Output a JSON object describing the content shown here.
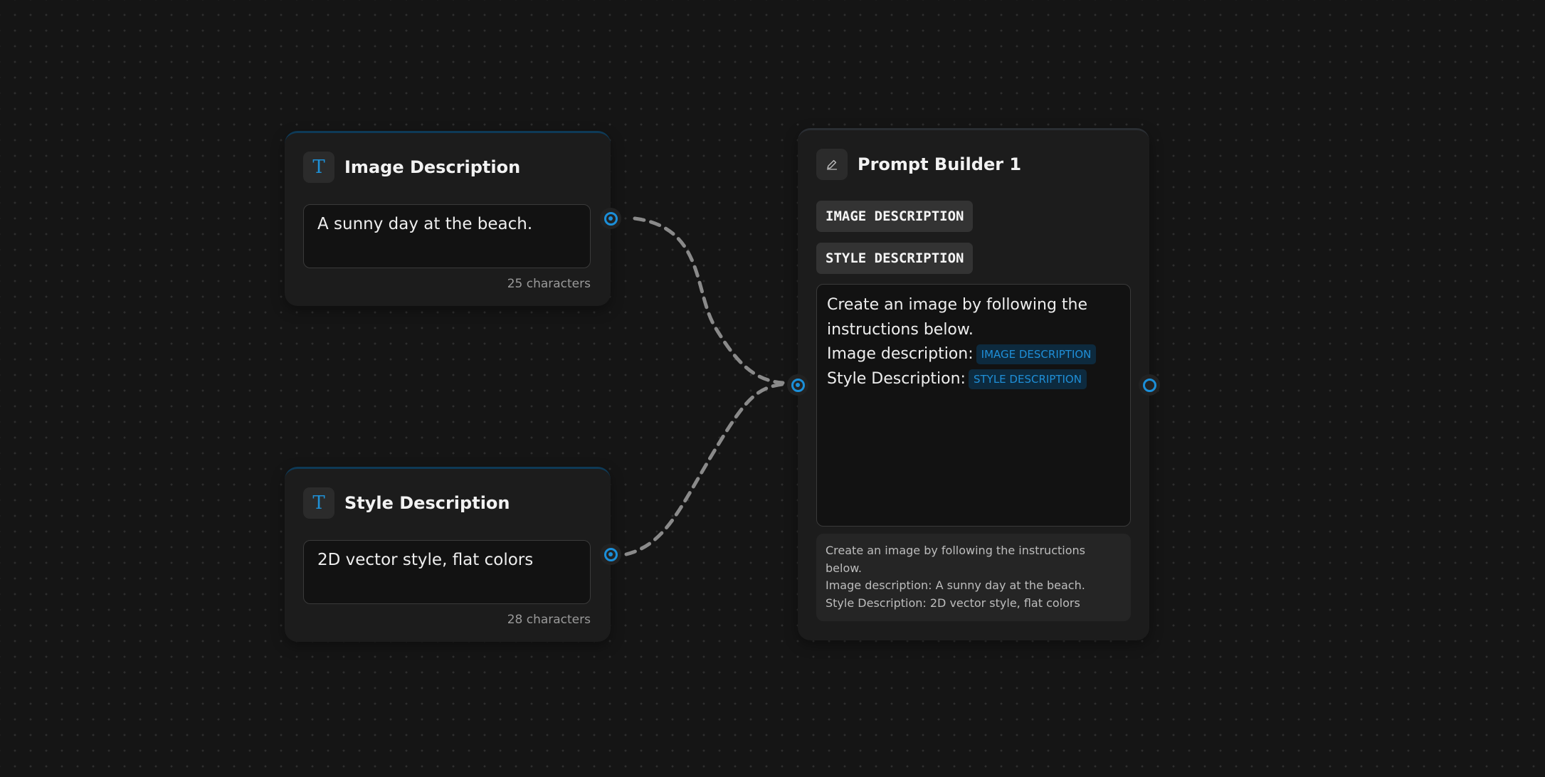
{
  "text_nodes": [
    {
      "title": "Image Description",
      "icon": "T",
      "value": "A sunny day at the beach.",
      "char_count": "25 characters"
    },
    {
      "title": "Style Description",
      "icon": "T",
      "value": "2D vector style, flat colors",
      "char_count": "28 characters"
    }
  ],
  "prompt_builder": {
    "title": "Prompt Builder 1",
    "icon": "pencil-icon",
    "variables": [
      "IMAGE DESCRIPTION",
      "STYLE DESCRIPTION"
    ],
    "template": {
      "line1": "Create an image by following the",
      "line2": "instructions below.",
      "line3_prefix": "Image description:",
      "line3_var": "IMAGE DESCRIPTION",
      "line4_prefix": "Style Description:",
      "line4_var": "STYLE DESCRIPTION"
    },
    "preview": {
      "line1": "Create an image by following the instructions",
      "line2": "below.",
      "line3": "Image description: A sunny day at the beach.",
      "line4": "Style Description: 2D vector style, flat colors"
    }
  },
  "colors": {
    "accent": "#1b8fd9",
    "background": "#151515",
    "node": "#1c1c1c",
    "edge": "#8a8a8a"
  }
}
